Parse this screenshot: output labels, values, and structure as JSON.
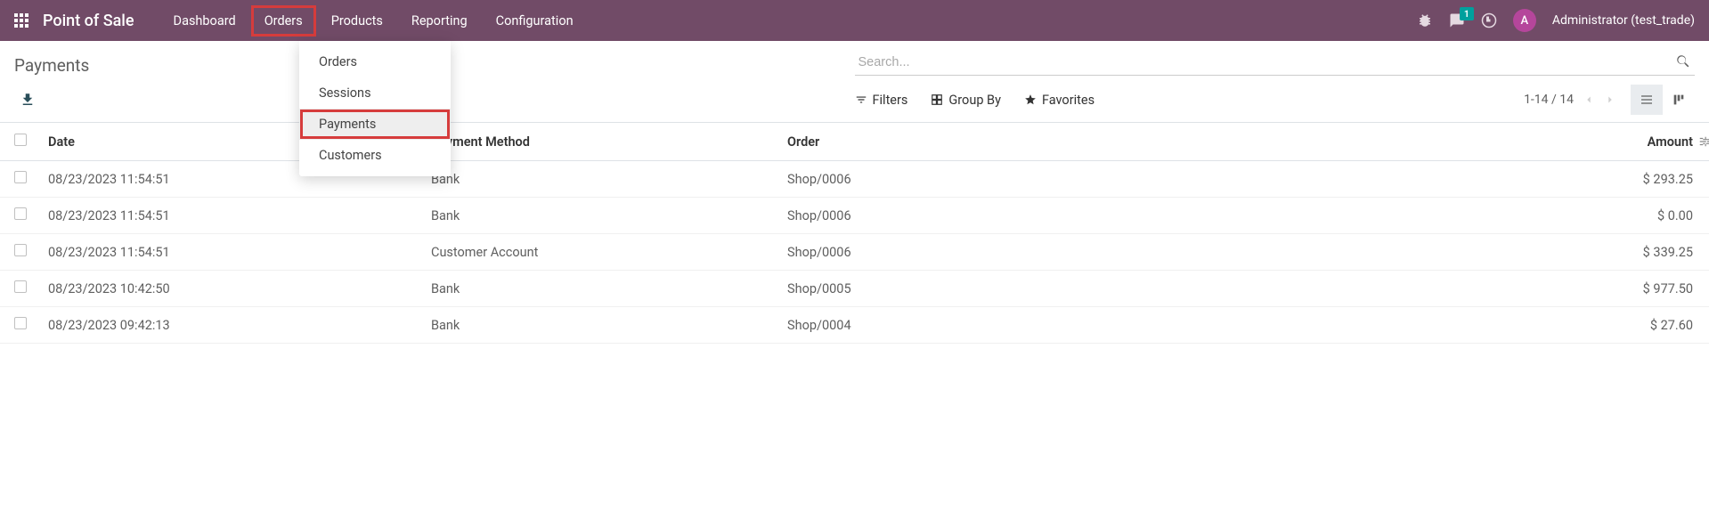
{
  "navbar": {
    "brand": "Point of Sale",
    "menu": [
      {
        "label": "Dashboard"
      },
      {
        "label": "Orders",
        "highlighted": true
      },
      {
        "label": "Products"
      },
      {
        "label": "Reporting"
      },
      {
        "label": "Configuration"
      }
    ],
    "message_badge": "1",
    "user_initial": "A",
    "username": "Administrator (test_trade)"
  },
  "dropdown": {
    "items": [
      {
        "label": "Orders"
      },
      {
        "label": "Sessions"
      },
      {
        "label": "Payments",
        "active": true
      },
      {
        "label": "Customers"
      }
    ]
  },
  "page": {
    "title": "Payments",
    "search_placeholder": "Search...",
    "filters_label": "Filters",
    "groupby_label": "Group By",
    "favorites_label": "Favorites",
    "pager": "1-14 / 14"
  },
  "table": {
    "headers": {
      "date": "Date",
      "method": "Payment Method",
      "order": "Order",
      "amount": "Amount"
    },
    "rows": [
      {
        "date": "08/23/2023 11:54:51",
        "method": "Bank",
        "order": "Shop/0006",
        "amount": "$ 293.25"
      },
      {
        "date": "08/23/2023 11:54:51",
        "method": "Bank",
        "order": "Shop/0006",
        "amount": "$ 0.00"
      },
      {
        "date": "08/23/2023 11:54:51",
        "method": "Customer Account",
        "order": "Shop/0006",
        "amount": "$ 339.25"
      },
      {
        "date": "08/23/2023 10:42:50",
        "method": "Bank",
        "order": "Shop/0005",
        "amount": "$ 977.50"
      },
      {
        "date": "08/23/2023 09:42:13",
        "method": "Bank",
        "order": "Shop/0004",
        "amount": "$ 27.60"
      }
    ]
  }
}
